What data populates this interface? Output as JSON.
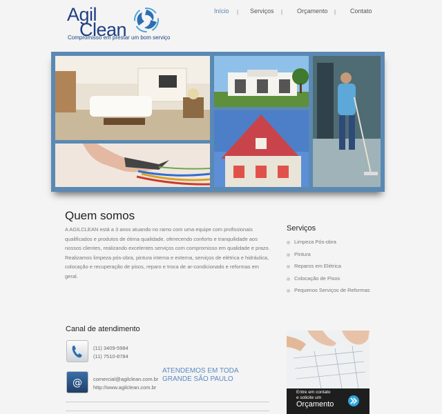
{
  "logo": {
    "part1": "Agil",
    "part2": "Clean",
    "tagline": "Compromisso em prestar um bom serviço"
  },
  "nav": {
    "items": [
      {
        "label": "Início",
        "active": true
      },
      {
        "label": "Serviços",
        "active": false
      },
      {
        "label": "Orçamento",
        "active": false
      },
      {
        "label": "Contato",
        "active": false
      }
    ],
    "separator": "|"
  },
  "colors": {
    "brand": "#1d3f84",
    "accent": "#5a7fb5",
    "banner_frame": "#5a89b3"
  },
  "banner": {
    "images": [
      "living-room-photo",
      "house-front-photo",
      "cleaner-mopping-photo",
      "pliers-wires-photo",
      "red-roof-house-photo"
    ]
  },
  "about": {
    "title": "Quem somos",
    "paragraph1": "A AGILCLEAN está a 3 anos atuando no ramo com uma equipe com profissionais qualificados e produtos de ótima qualidade, oferecendo conforto e tranquilidade aos nossos clientes, realizando excelentes serviços com compromisso em qualidade e prazo.",
    "paragraph2": "Realizamos limpeza pós-obra, pintura interna e externa, serviços de elétrica e hidráulica, colocação e recuperação de pisos, reparo e troca de ar-condicionado e reformas em geral."
  },
  "services": {
    "title": "Serviços",
    "items": [
      "Limpeza Pós-obra",
      "Pintura",
      "Reparos em Elétrica",
      "Colocação de Pisos",
      "Pequenos Serviços de Reformas"
    ]
  },
  "contact": {
    "title": "Canal de atendimento",
    "phone1": "(11) 3409-5984",
    "phone2": "(11) 7510-8784",
    "email": "comercial@agilclean.com.br",
    "website": "http://www.agilclean.com.br",
    "coverage_line1": "ATENDEMOS EM TODA",
    "coverage_line2": "GRANDE SÃO PAULO",
    "icons": [
      "phone-icon",
      "email-icon"
    ]
  },
  "promo": {
    "small_line1": "Entre em contato",
    "small_line2": "e solicite um",
    "big": "Orçamento",
    "icon": "arrow-circle-icon"
  }
}
